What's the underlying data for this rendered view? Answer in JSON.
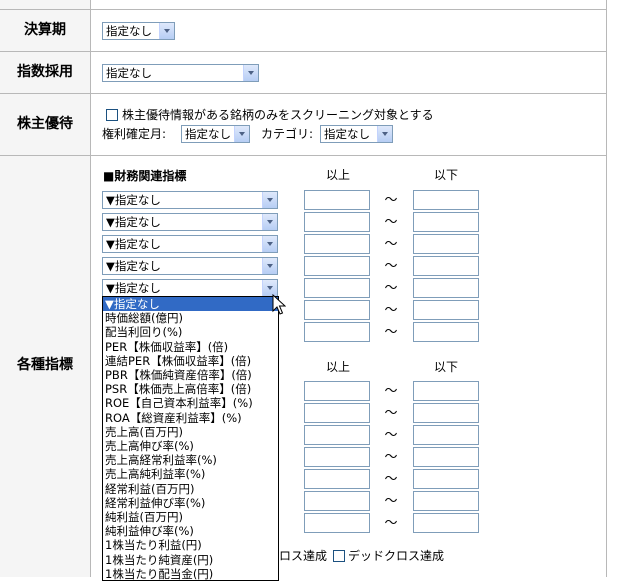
{
  "rows": {
    "settlement": {
      "label": "決算期",
      "select": "指定なし"
    },
    "index": {
      "label": "指数採用",
      "select": "指定なし"
    },
    "yutai": {
      "label": "株主優待",
      "checkbox_label": "株主優待情報がある銘柄のみをスクリーニング対象とする",
      "kenri_label": "権利確定月:",
      "kenri_select": "指定なし",
      "category_label": "カテゴリ:",
      "category_select": "指定なし"
    },
    "indicators": {
      "label": "各種指標",
      "section_title": "■財務関連指標",
      "min_label": "以上",
      "max_label": "以下",
      "tilde": "〜",
      "selects": [
        "▼指定なし",
        "▼指定なし",
        "▼指定なし",
        "▼指定なし",
        "▼指定なし"
      ],
      "golden_cross_suffix": "ロス達成",
      "dead_cross_label": "デッドクロス達成"
    }
  },
  "dropdown": {
    "items": [
      "▼指定なし",
      "時価総額(億円)",
      "配当利回り(%)",
      "PER【株価収益率】(倍)",
      "連結PER【株価収益率】(倍)",
      "PBR【株価純資産倍率】(倍)",
      "PSR【株価売上高倍率】(倍)",
      "ROE【自己資本利益率】(%)",
      "ROA【総資産利益率】(%)",
      "売上高(百万円)",
      "売上高伸び率(%)",
      "売上高経常利益率(%)",
      "売上高純利益率(%)",
      "経常利益(百万円)",
      "経常利益伸び率(%)",
      "純利益(百万円)",
      "純利益伸び率(%)",
      "1株当たり利益(円)",
      "1株当たり純資産(円)",
      "1株当たり配当金(円)"
    ],
    "selected_index": 0
  }
}
